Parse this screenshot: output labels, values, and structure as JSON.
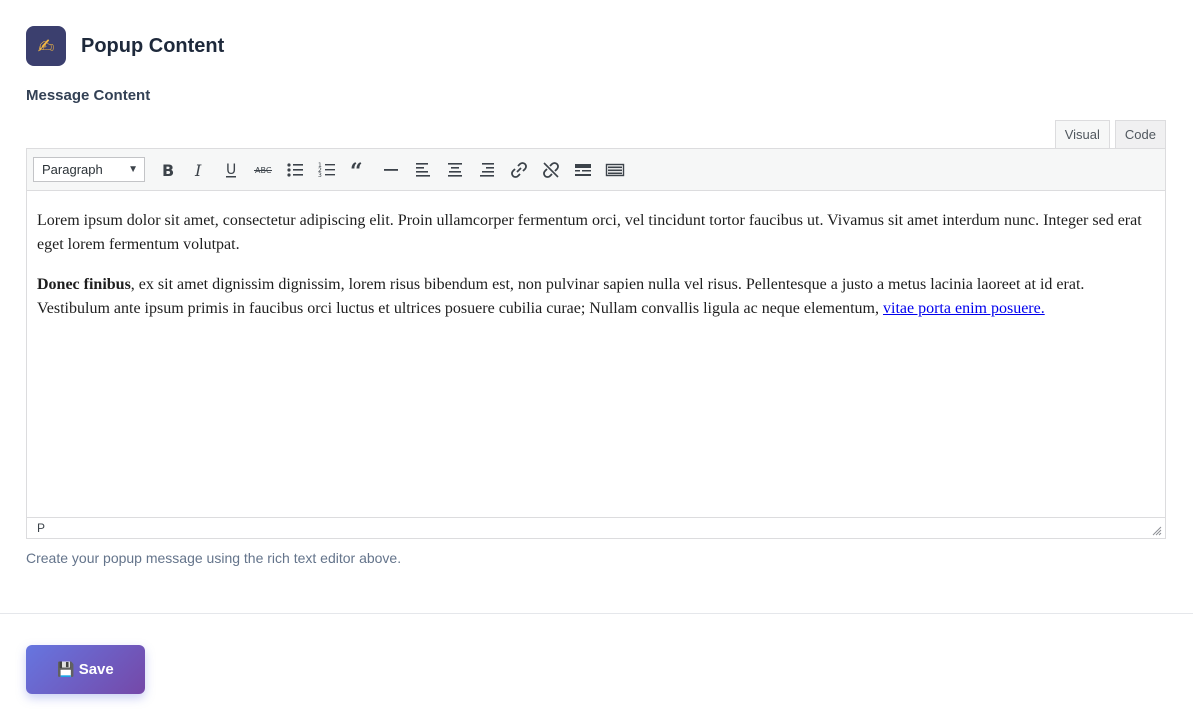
{
  "header": {
    "icon": "writing-hand-icon",
    "title": "Popup Content"
  },
  "section": {
    "label": "Message Content"
  },
  "editor": {
    "tabs": [
      {
        "label": "Visual",
        "active": true
      },
      {
        "label": "Code",
        "active": false
      }
    ],
    "format_select": "Paragraph",
    "toolbar_buttons": [
      "bold",
      "italic",
      "underline",
      "strikethrough",
      "bullet-list",
      "numbered-list",
      "blockquote",
      "horizontal-rule",
      "align-left",
      "align-center",
      "align-right",
      "insert-link",
      "remove-link",
      "read-more",
      "toolbar-toggle"
    ],
    "paragraph1": "Lorem ipsum dolor sit amet, consectetur adipiscing elit. Proin ullamcorper fermentum orci, vel tincidunt tortor faucibus ut. Vivamus sit amet interdum nunc. Integer sed erat eget lorem fermentum volutpat.",
    "paragraph2_bold": "Donec finibus",
    "paragraph2_text": ", ex sit amet dignissim dignissim, lorem risus bibendum est, non pulvinar sapien nulla vel risus. Pellentesque a justo a metus lacinia laoreet at id erat. Vestibulum ante ipsum primis in faucibus orci luctus et ultrices posuere cubilia curae; Nullam convallis ligula ac neque elementum, ",
    "paragraph2_link": "vitae porta enim posuere.",
    "status_path": "P"
  },
  "help_text": "Create your popup message using the rich text editor above.",
  "save_button": {
    "label": "Save",
    "icon": "floppy-disk-icon"
  },
  "colors": {
    "accent_start": "#6676e0",
    "accent_end": "#7548a8",
    "icon_bg": "#3b3f6e"
  }
}
